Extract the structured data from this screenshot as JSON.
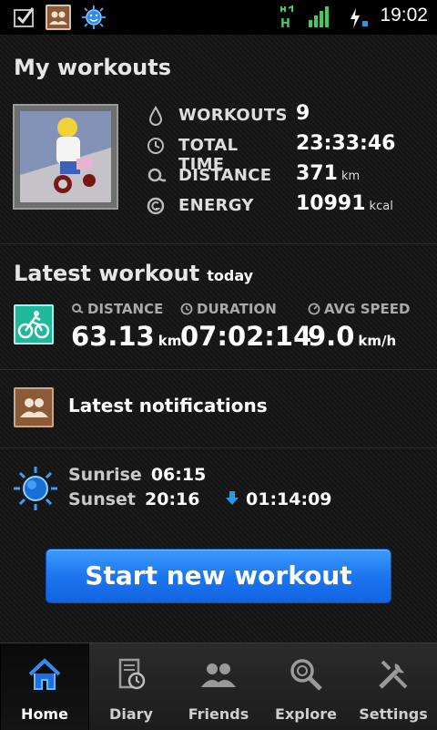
{
  "status_bar": {
    "time": "19:02",
    "network_indicator": "H"
  },
  "my_workouts": {
    "title": "My workouts",
    "stats": [
      {
        "icon": "drop-icon",
        "label": "WORKOUTS",
        "value": "9",
        "unit": ""
      },
      {
        "icon": "clock-icon",
        "label": "TOTAL TIME",
        "value": "23:33:46",
        "unit": ""
      },
      {
        "icon": "distance-icon",
        "label": "DISTANCE",
        "value": "371",
        "unit": "km"
      },
      {
        "icon": "energy-icon",
        "label": "ENERGY",
        "value": "10991",
        "unit": "kcal"
      }
    ]
  },
  "latest_workout": {
    "title": "Latest workout",
    "when": "today",
    "distance": {
      "label": "DISTANCE",
      "value": "63.13",
      "unit": "km"
    },
    "duration": {
      "label": "DURATION",
      "value": "07:02:14"
    },
    "avg_speed": {
      "label": "AVG SPEED",
      "value": "9.0",
      "unit": "km/h"
    }
  },
  "notifications": {
    "label": "Latest notifications"
  },
  "sun": {
    "sunrise_label": "Sunrise",
    "sunrise_time": "06:15",
    "sunset_label": "Sunset",
    "sunset_time": "20:16",
    "countdown": "01:14:09"
  },
  "start_button": {
    "label": "Start new workout"
  },
  "nav": [
    {
      "label": "Home",
      "icon": "home-icon",
      "active": true
    },
    {
      "label": "Diary",
      "icon": "diary-icon",
      "active": false
    },
    {
      "label": "Friends",
      "icon": "friends-icon",
      "active": false
    },
    {
      "label": "Explore",
      "icon": "explore-icon",
      "active": false
    },
    {
      "label": "Settings",
      "icon": "settings-icon",
      "active": false
    }
  ],
  "colors": {
    "accent_blue": "#1d76ee",
    "bike_green": "#1fb89a",
    "notif_brown": "#8a5a3a"
  }
}
